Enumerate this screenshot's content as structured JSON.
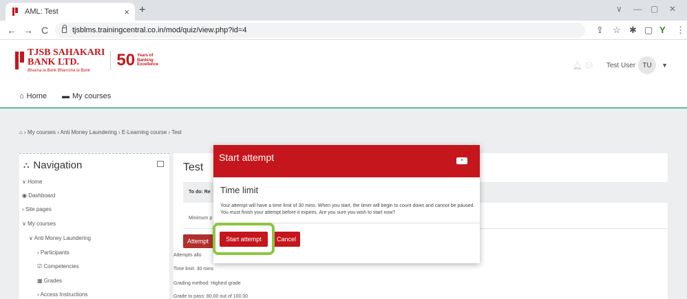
{
  "browser": {
    "tab_title": "AML: Test",
    "tab_close": "×",
    "new_tab": "+",
    "url": "tjsblms.trainingcentral.co.in/mod/quiz/view.php?id=4",
    "back": "←",
    "forward": "→",
    "reload": "C",
    "window_controls": [
      "∨",
      "—",
      "▢",
      "✕"
    ],
    "extension_icons": [
      "⇪",
      "☆",
      "✱",
      "▢",
      "Y",
      "⋮"
    ]
  },
  "header": {
    "logo_line1": "TJSB SAHAKARI",
    "logo_line2": "BANK LTD.",
    "logo_tagline": "Bhavna la Bank Bharosha la Bank",
    "anniv_number": "50",
    "anniv_text": "Years of Banking Excellence",
    "user_name": "Test User",
    "user_initials": "TU",
    "nav": [
      {
        "label": "Home",
        "icon": "home-icon"
      },
      {
        "label": "My courses",
        "icon": "briefcase-icon"
      }
    ]
  },
  "breadcrumb": "⌂ › My courses › Anti Money Laundering › E-Learning course › Test",
  "navigation": {
    "title": "Navigation",
    "items": [
      {
        "label": "∨ Home"
      },
      {
        "label": "Dashboard"
      },
      {
        "label": "› Site pages"
      },
      {
        "label": "∨ My courses"
      },
      {
        "label": "∨ Anti Money Laundering"
      },
      {
        "label": "› Participants"
      },
      {
        "label": "Competencies"
      },
      {
        "label": "Grades"
      },
      {
        "label": "› Access Instructions"
      }
    ]
  },
  "content": {
    "title": "Test",
    "todo": "To do: Re",
    "minimum": "Minimum p",
    "attempt_button": "Attempt",
    "info": [
      "Attempts allo",
      "Time limit: 30 mins",
      "Grading method: Highest grade",
      "Grade to pass: 80.00 out of 100.00"
    ]
  },
  "modal": {
    "title": "Start attempt",
    "close_label": "×",
    "subtitle": "Time limit",
    "text": "Your attempt will have a time limit of 30 mins. When you start, the timer will begin to count down and cannot be paused. You must finish your attempt before it expires. Are you sure you wish to start now?",
    "start_label": "Start attempt",
    "cancel_label": "Cancel"
  },
  "colors": {
    "brand_red": "#c4161c",
    "highlight_green": "#8dc63f",
    "header_rule": "#5ab6a0"
  }
}
